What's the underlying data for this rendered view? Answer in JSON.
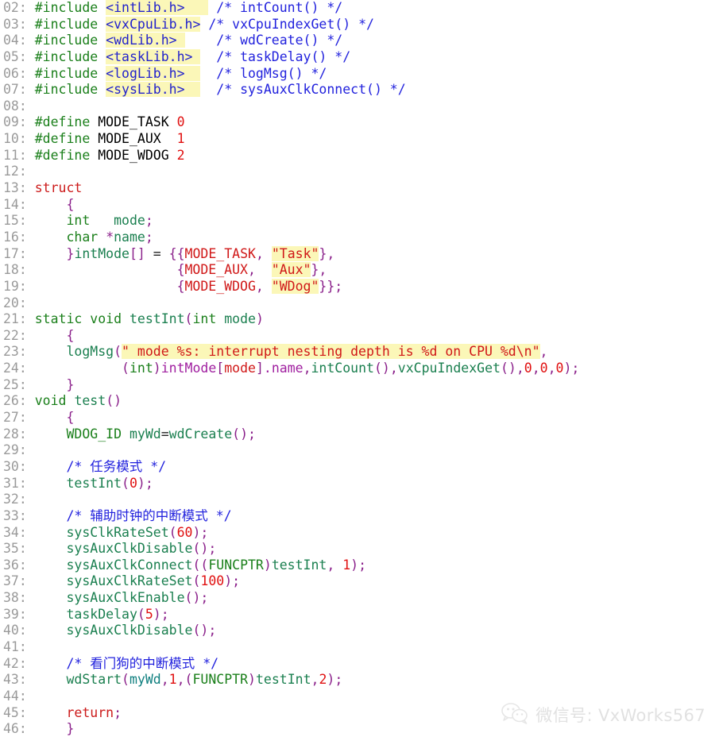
{
  "document": {
    "title": "VxWorks interrupt mode demo source listing",
    "language": "C",
    "first_line_number": "02",
    "last_line_number": "46",
    "background_color": "#ffffff",
    "highlight_color": "#fbf7b8",
    "gutter_color": "#9a9a9a"
  },
  "palette": {
    "preprocessor": "#1a7f1a",
    "header_name": "#2222cc",
    "comment": "#2222dd",
    "macro_define": "#2222cc",
    "macro_use": "#d01818",
    "number": "#e01010",
    "keyword": "#cc1a1a",
    "type": "#1a7f1a",
    "function": "#1a7f4f",
    "variable": "#0f7f7f",
    "member": "#a020a0",
    "punctuation": "#8a1f8a",
    "string": "#d01818"
  },
  "lines": [
    {
      "n": "02",
      "text": "#include <intLib.h>    /* intCount() */"
    },
    {
      "n": "03",
      "text": "#include <vxCpuLib.h> /* vxCpuIndexGet() */"
    },
    {
      "n": "04",
      "text": "#include <wdLib.h>     /* wdCreate() */"
    },
    {
      "n": "05",
      "text": "#include <taskLib.h>   /* taskDelay() */"
    },
    {
      "n": "06",
      "text": "#include <logLib.h>    /* logMsg() */"
    },
    {
      "n": "07",
      "text": "#include <sysLib.h>    /* sysAuxClkConnect() */"
    },
    {
      "n": "08",
      "text": ""
    },
    {
      "n": "09",
      "text": "#define MODE_TASK 0"
    },
    {
      "n": "10",
      "text": "#define MODE_AUX  1"
    },
    {
      "n": "11",
      "text": "#define MODE_WDOG 2"
    },
    {
      "n": "12",
      "text": ""
    },
    {
      "n": "13",
      "text": "struct"
    },
    {
      "n": "14",
      "text": "    {"
    },
    {
      "n": "15",
      "text": "    int   mode;"
    },
    {
      "n": "16",
      "text": "    char *name;"
    },
    {
      "n": "17",
      "text": "    }intMode[] = {{MODE_TASK, \"Task\"},"
    },
    {
      "n": "18",
      "text": "                  {MODE_AUX,  \"Aux\"},"
    },
    {
      "n": "19",
      "text": "                  {MODE_WDOG, \"WDog\"}};"
    },
    {
      "n": "20",
      "text": ""
    },
    {
      "n": "21",
      "text": "static void testInt(int mode)"
    },
    {
      "n": "22",
      "text": "    {"
    },
    {
      "n": "23",
      "text": "    logMsg(\" mode %s: interrupt nesting depth is %d on CPU %d\\n\","
    },
    {
      "n": "24",
      "text": "           (int)intMode[mode].name,intCount(),vxCpuIndexGet(),0,0,0);"
    },
    {
      "n": "25",
      "text": "    }"
    },
    {
      "n": "26",
      "text": "void test()"
    },
    {
      "n": "27",
      "text": "    {"
    },
    {
      "n": "28",
      "text": "    WDOG_ID myWd=wdCreate();"
    },
    {
      "n": "29",
      "text": ""
    },
    {
      "n": "30",
      "text": "    /* 任务模式 */"
    },
    {
      "n": "31",
      "text": "    testInt(0);"
    },
    {
      "n": "32",
      "text": ""
    },
    {
      "n": "33",
      "text": "    /* 辅助时钟的中断模式 */"
    },
    {
      "n": "34",
      "text": "    sysClkRateSet(60);"
    },
    {
      "n": "35",
      "text": "    sysAuxClkDisable();"
    },
    {
      "n": "36",
      "text": "    sysAuxClkConnect((FUNCPTR)testInt, 1);"
    },
    {
      "n": "37",
      "text": "    sysAuxClkRateSet(100);"
    },
    {
      "n": "38",
      "text": "    sysAuxClkEnable();"
    },
    {
      "n": "39",
      "text": "    taskDelay(5);"
    },
    {
      "n": "40",
      "text": "    sysAuxClkDisable();"
    },
    {
      "n": "41",
      "text": ""
    },
    {
      "n": "42",
      "text": "    /* 看门狗的中断模式 */"
    },
    {
      "n": "43",
      "text": "    wdStart(myWd,1,(FUNCPTR)testInt,2);"
    },
    {
      "n": "44",
      "text": ""
    },
    {
      "n": "45",
      "text": "    return;"
    },
    {
      "n": "46",
      "text": "    }"
    }
  ],
  "tokens": [
    [
      {
        "t": "#include",
        "c": "tok-pre"
      },
      {
        "t": " ",
        "c": "tok-plain"
      },
      {
        "t": "<intLib.h>   ",
        "c": "tok-header hl"
      },
      {
        "t": " ",
        "c": "tok-plain"
      },
      {
        "t": "/* intCount() */",
        "c": "tok-comment"
      }
    ],
    [
      {
        "t": "#include",
        "c": "tok-pre"
      },
      {
        "t": " ",
        "c": "tok-plain"
      },
      {
        "t": "<vxCpuLib.h>",
        "c": "tok-header hl"
      },
      {
        "t": " ",
        "c": "tok-plain"
      },
      {
        "t": "/* vxCpuIndexGet() */",
        "c": "tok-comment"
      }
    ],
    [
      {
        "t": "#include",
        "c": "tok-pre"
      },
      {
        "t": " ",
        "c": "tok-plain"
      },
      {
        "t": "<wdLib.h> ",
        "c": "tok-header hl"
      },
      {
        "t": "    ",
        "c": "tok-plain"
      },
      {
        "t": "/* wdCreate() */",
        "c": "tok-comment"
      }
    ],
    [
      {
        "t": "#include",
        "c": "tok-pre"
      },
      {
        "t": " ",
        "c": "tok-plain"
      },
      {
        "t": "<taskLib.h> ",
        "c": "tok-header hl"
      },
      {
        "t": "  ",
        "c": "tok-plain"
      },
      {
        "t": "/* taskDelay() */",
        "c": "tok-comment"
      }
    ],
    [
      {
        "t": "#include",
        "c": "tok-pre"
      },
      {
        "t": " ",
        "c": "tok-plain"
      },
      {
        "t": "<logLib.h>  ",
        "c": "tok-header hl"
      },
      {
        "t": "  ",
        "c": "tok-plain"
      },
      {
        "t": "/* logMsg() */",
        "c": "tok-comment"
      }
    ],
    [
      {
        "t": "#include",
        "c": "tok-pre"
      },
      {
        "t": " ",
        "c": "tok-plain"
      },
      {
        "t": "<sysLib.h>  ",
        "c": "tok-header hl"
      },
      {
        "t": "  ",
        "c": "tok-plain"
      },
      {
        "t": "/* sysAuxClkConnect() */",
        "c": "tok-comment"
      }
    ],
    [],
    [
      {
        "t": "#define",
        "c": "tok-pre"
      },
      {
        "t": " ",
        "c": "tok-plain"
      },
      {
        "t": "MODE_TASK",
        "c": "tok-macro"
      },
      {
        "t": " ",
        "c": "tok-plain"
      },
      {
        "t": "0",
        "c": "tok-num"
      }
    ],
    [
      {
        "t": "#define",
        "c": "tok-pre"
      },
      {
        "t": " ",
        "c": "tok-plain"
      },
      {
        "t": "MODE_AUX",
        "c": "tok-macro"
      },
      {
        "t": "  ",
        "c": "tok-plain"
      },
      {
        "t": "1",
        "c": "tok-num"
      }
    ],
    [
      {
        "t": "#define",
        "c": "tok-pre"
      },
      {
        "t": " ",
        "c": "tok-plain"
      },
      {
        "t": "MODE_WDOG",
        "c": "tok-macro"
      },
      {
        "t": " ",
        "c": "tok-plain"
      },
      {
        "t": "2",
        "c": "tok-num"
      }
    ],
    [],
    [
      {
        "t": "struct",
        "c": "tok-kw"
      }
    ],
    [
      {
        "t": "    ",
        "c": "tok-plain"
      },
      {
        "t": "{",
        "c": "tok-brace"
      }
    ],
    [
      {
        "t": "    ",
        "c": "tok-plain"
      },
      {
        "t": "int",
        "c": "tok-type"
      },
      {
        "t": "   ",
        "c": "tok-plain"
      },
      {
        "t": "mode",
        "c": "tok-ident"
      },
      {
        "t": ";",
        "c": "tok-punct"
      }
    ],
    [
      {
        "t": "    ",
        "c": "tok-plain"
      },
      {
        "t": "char",
        "c": "tok-type"
      },
      {
        "t": " ",
        "c": "tok-plain"
      },
      {
        "t": "*",
        "c": "tok-punct"
      },
      {
        "t": "name",
        "c": "tok-ident"
      },
      {
        "t": ";",
        "c": "tok-punct"
      }
    ],
    [
      {
        "t": "    ",
        "c": "tok-plain"
      },
      {
        "t": "}",
        "c": "tok-brace"
      },
      {
        "t": "intMode",
        "c": "tok-ident"
      },
      {
        "t": "[]",
        "c": "tok-punct"
      },
      {
        "t": " = ",
        "c": "tok-plain"
      },
      {
        "t": "{{",
        "c": "tok-brace"
      },
      {
        "t": "MODE_TASK",
        "c": "tok-macrouse"
      },
      {
        "t": ", ",
        "c": "tok-punct"
      },
      {
        "t": "\"Task\"",
        "c": "tok-str hl"
      },
      {
        "t": "}",
        "c": "tok-brace"
      },
      {
        "t": ",",
        "c": "tok-punct"
      }
    ],
    [
      {
        "t": "                  ",
        "c": "tok-plain"
      },
      {
        "t": "{",
        "c": "tok-brace"
      },
      {
        "t": "MODE_AUX",
        "c": "tok-macrouse"
      },
      {
        "t": ",  ",
        "c": "tok-punct"
      },
      {
        "t": "\"Aux\"",
        "c": "tok-str hl"
      },
      {
        "t": "}",
        "c": "tok-brace"
      },
      {
        "t": ",",
        "c": "tok-punct"
      }
    ],
    [
      {
        "t": "                  ",
        "c": "tok-plain"
      },
      {
        "t": "{",
        "c": "tok-brace"
      },
      {
        "t": "MODE_WDOG",
        "c": "tok-macrouse"
      },
      {
        "t": ", ",
        "c": "tok-punct"
      },
      {
        "t": "\"WDog\"",
        "c": "tok-str hl"
      },
      {
        "t": "}}",
        "c": "tok-brace"
      },
      {
        "t": ";",
        "c": "tok-punct"
      }
    ],
    [],
    [
      {
        "t": "static",
        "c": "tok-type"
      },
      {
        "t": " ",
        "c": "tok-plain"
      },
      {
        "t": "void",
        "c": "tok-type"
      },
      {
        "t": " ",
        "c": "tok-plain"
      },
      {
        "t": "testInt",
        "c": "tok-fn"
      },
      {
        "t": "(",
        "c": "tok-punct"
      },
      {
        "t": "int",
        "c": "tok-type"
      },
      {
        "t": " ",
        "c": "tok-plain"
      },
      {
        "t": "mode",
        "c": "tok-ident"
      },
      {
        "t": ")",
        "c": "tok-punct"
      }
    ],
    [
      {
        "t": "    ",
        "c": "tok-plain"
      },
      {
        "t": "{",
        "c": "tok-brace"
      }
    ],
    [
      {
        "t": "    ",
        "c": "tok-plain"
      },
      {
        "t": "logMsg",
        "c": "tok-fn"
      },
      {
        "t": "(",
        "c": "tok-punct"
      },
      {
        "t": "\" mode %s: interrupt nesting depth is %d on CPU %d\\n\"",
        "c": "tok-str hl"
      },
      {
        "t": ",",
        "c": "tok-punct"
      }
    ],
    [
      {
        "t": "           ",
        "c": "tok-plain"
      },
      {
        "t": "(",
        "c": "tok-punct"
      },
      {
        "t": "int",
        "c": "tok-type"
      },
      {
        "t": ")",
        "c": "tok-punct"
      },
      {
        "t": "intMode",
        "c": "tok-member"
      },
      {
        "t": "[",
        "c": "tok-punct"
      },
      {
        "t": "mode",
        "c": "tok-macrouse"
      },
      {
        "t": "]",
        "c": "tok-punct"
      },
      {
        "t": ".name",
        "c": "tok-member"
      },
      {
        "t": ",",
        "c": "tok-punct"
      },
      {
        "t": "intCount",
        "c": "tok-fn"
      },
      {
        "t": "()",
        "c": "tok-punct"
      },
      {
        "t": ",",
        "c": "tok-punct"
      },
      {
        "t": "vxCpuIndexGet",
        "c": "tok-fn"
      },
      {
        "t": "()",
        "c": "tok-punct"
      },
      {
        "t": ",",
        "c": "tok-punct"
      },
      {
        "t": "0",
        "c": "tok-num"
      },
      {
        "t": ",",
        "c": "tok-punct"
      },
      {
        "t": "0",
        "c": "tok-num"
      },
      {
        "t": ",",
        "c": "tok-punct"
      },
      {
        "t": "0",
        "c": "tok-num"
      },
      {
        "t": ")",
        "c": "tok-punct"
      },
      {
        "t": ";",
        "c": "tok-punct"
      }
    ],
    [
      {
        "t": "    ",
        "c": "tok-plain"
      },
      {
        "t": "}",
        "c": "tok-brace"
      }
    ],
    [
      {
        "t": "void",
        "c": "tok-type"
      },
      {
        "t": " ",
        "c": "tok-plain"
      },
      {
        "t": "test",
        "c": "tok-fn"
      },
      {
        "t": "()",
        "c": "tok-punct"
      }
    ],
    [
      {
        "t": "    ",
        "c": "tok-plain"
      },
      {
        "t": "{",
        "c": "tok-brace"
      }
    ],
    [
      {
        "t": "    ",
        "c": "tok-plain"
      },
      {
        "t": "WDOG_ID",
        "c": "tok-type"
      },
      {
        "t": " ",
        "c": "tok-plain"
      },
      {
        "t": "myWd",
        "c": "tok-ident"
      },
      {
        "t": "=",
        "c": "tok-plain"
      },
      {
        "t": "wdCreate",
        "c": "tok-fn"
      },
      {
        "t": "()",
        "c": "tok-punct"
      },
      {
        "t": ";",
        "c": "tok-punct"
      }
    ],
    [],
    [
      {
        "t": "    ",
        "c": "tok-plain"
      },
      {
        "t": "/* 任务模式 */",
        "c": "tok-comment"
      }
    ],
    [
      {
        "t": "    ",
        "c": "tok-plain"
      },
      {
        "t": "testInt",
        "c": "tok-fn"
      },
      {
        "t": "(",
        "c": "tok-punct"
      },
      {
        "t": "0",
        "c": "tok-num"
      },
      {
        "t": ")",
        "c": "tok-punct"
      },
      {
        "t": ";",
        "c": "tok-punct"
      }
    ],
    [],
    [
      {
        "t": "    ",
        "c": "tok-plain"
      },
      {
        "t": "/* 辅助时钟的中断模式 */",
        "c": "tok-comment"
      }
    ],
    [
      {
        "t": "    ",
        "c": "tok-plain"
      },
      {
        "t": "sysClkRateSet",
        "c": "tok-fn"
      },
      {
        "t": "(",
        "c": "tok-punct"
      },
      {
        "t": "60",
        "c": "tok-num"
      },
      {
        "t": ")",
        "c": "tok-punct"
      },
      {
        "t": ";",
        "c": "tok-punct"
      }
    ],
    [
      {
        "t": "    ",
        "c": "tok-plain"
      },
      {
        "t": "sysAuxClkDisable",
        "c": "tok-fn"
      },
      {
        "t": "()",
        "c": "tok-punct"
      },
      {
        "t": ";",
        "c": "tok-punct"
      }
    ],
    [
      {
        "t": "    ",
        "c": "tok-plain"
      },
      {
        "t": "sysAuxClkConnect",
        "c": "tok-fn"
      },
      {
        "t": "((",
        "c": "tok-punct"
      },
      {
        "t": "FUNCPTR",
        "c": "tok-type"
      },
      {
        "t": ")",
        "c": "tok-punct"
      },
      {
        "t": "testInt",
        "c": "tok-fn"
      },
      {
        "t": ", ",
        "c": "tok-punct"
      },
      {
        "t": "1",
        "c": "tok-num"
      },
      {
        "t": ")",
        "c": "tok-punct"
      },
      {
        "t": ";",
        "c": "tok-punct"
      }
    ],
    [
      {
        "t": "    ",
        "c": "tok-plain"
      },
      {
        "t": "sysAuxClkRateSet",
        "c": "tok-fn"
      },
      {
        "t": "(",
        "c": "tok-punct"
      },
      {
        "t": "100",
        "c": "tok-num"
      },
      {
        "t": ")",
        "c": "tok-punct"
      },
      {
        "t": ";",
        "c": "tok-punct"
      }
    ],
    [
      {
        "t": "    ",
        "c": "tok-plain"
      },
      {
        "t": "sysAuxClkEnable",
        "c": "tok-fn"
      },
      {
        "t": "()",
        "c": "tok-punct"
      },
      {
        "t": ";",
        "c": "tok-punct"
      }
    ],
    [
      {
        "t": "    ",
        "c": "tok-plain"
      },
      {
        "t": "taskDelay",
        "c": "tok-fn"
      },
      {
        "t": "(",
        "c": "tok-punct"
      },
      {
        "t": "5",
        "c": "tok-num"
      },
      {
        "t": ")",
        "c": "tok-punct"
      },
      {
        "t": ";",
        "c": "tok-punct"
      }
    ],
    [
      {
        "t": "    ",
        "c": "tok-plain"
      },
      {
        "t": "sysAuxClkDisable",
        "c": "tok-fn"
      },
      {
        "t": "()",
        "c": "tok-punct"
      },
      {
        "t": ";",
        "c": "tok-punct"
      }
    ],
    [],
    [
      {
        "t": "    ",
        "c": "tok-plain"
      },
      {
        "t": "/* 看门狗的中断模式 */",
        "c": "tok-comment"
      }
    ],
    [
      {
        "t": "    ",
        "c": "tok-plain"
      },
      {
        "t": "wdStart",
        "c": "tok-fn"
      },
      {
        "t": "(",
        "c": "tok-punct"
      },
      {
        "t": "myWd",
        "c": "tok-var"
      },
      {
        "t": ",",
        "c": "tok-punct"
      },
      {
        "t": "1",
        "c": "tok-num"
      },
      {
        "t": ",(",
        "c": "tok-punct"
      },
      {
        "t": "FUNCPTR",
        "c": "tok-type"
      },
      {
        "t": ")",
        "c": "tok-punct"
      },
      {
        "t": "testInt",
        "c": "tok-fn"
      },
      {
        "t": ",",
        "c": "tok-punct"
      },
      {
        "t": "2",
        "c": "tok-num"
      },
      {
        "t": ")",
        "c": "tok-punct"
      },
      {
        "t": ";",
        "c": "tok-punct"
      }
    ],
    [],
    [
      {
        "t": "    ",
        "c": "tok-plain"
      },
      {
        "t": "return",
        "c": "tok-kw"
      },
      {
        "t": ";",
        "c": "tok-punct"
      }
    ],
    [
      {
        "t": "    ",
        "c": "tok-plain"
      },
      {
        "t": "}",
        "c": "tok-brace"
      }
    ]
  ],
  "watermark": {
    "icon": "wechat-icon",
    "text": "微信号: VxWorks567",
    "color": "#c9c9c9"
  }
}
